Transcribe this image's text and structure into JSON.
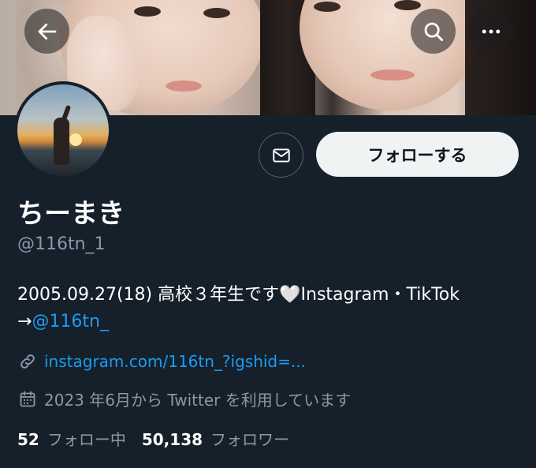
{
  "profile": {
    "display_name": "ちーまき",
    "handle": "@116tn_1",
    "bio_line1_text": "2005.09.27(18) 高校３年生です",
    "bio_heart": "🤍",
    "bio_line1_tail": "Instagram・TikTok",
    "bio_line2_arrow": "→",
    "bio_line2_mention": "@116tn_",
    "link_text": "instagram.com/116tn_?igshid=...",
    "joined_text": "2023 年6月から Twitter を利用しています"
  },
  "actions": {
    "follow_label": "フォローする"
  },
  "stats": {
    "following_count": "52",
    "following_label": "フォロー中",
    "followers_count": "50,138",
    "followers_label": "フォロワー"
  },
  "icons": {
    "back": "arrow-left-icon",
    "search": "search-icon",
    "more": "more-horizontal-icon",
    "message": "envelope-icon",
    "link": "link-icon",
    "calendar": "calendar-icon"
  },
  "colors": {
    "background": "#15202b",
    "accent": "#1d9bf0",
    "muted": "#8b98a5",
    "follow_button_bg": "#eff3f4"
  }
}
